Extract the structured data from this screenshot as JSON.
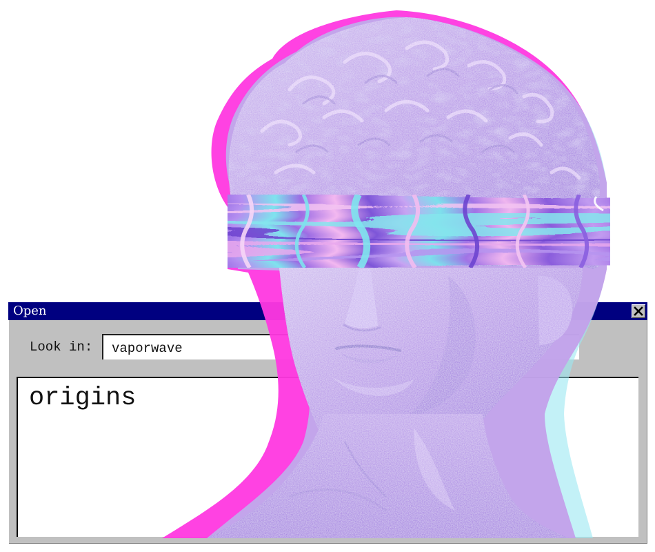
{
  "window": {
    "title": "Open",
    "close_icon": "close-icon"
  },
  "look_in": {
    "label": "Look in:",
    "value": "vaporwave"
  },
  "file_list": {
    "items": [
      "origins"
    ]
  },
  "colors": {
    "titlebar": "#000080",
    "dialog_face": "#c0c0c0",
    "field_background": "#ffffff",
    "statue_purple": "#a77be0",
    "statue_magenta": "#ff3fe0",
    "statue_cyan": "#9ae8f0"
  },
  "illustration": {
    "subject": "statue-bust-icon",
    "effect": "glitch-band"
  }
}
